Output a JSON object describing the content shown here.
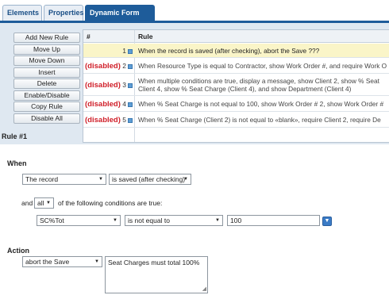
{
  "tabs": [
    {
      "label": "Elements"
    },
    {
      "label": "Properties"
    },
    {
      "label": "Dynamic Form Rules"
    }
  ],
  "sidebar_buttons": [
    "Add New Rule",
    "Move Up",
    "Move Down",
    "Insert",
    "Delete",
    "Enable/Disable",
    "Copy Rule",
    "Disable All"
  ],
  "grid": {
    "header_num": "#",
    "header_rule": "Rule",
    "rows": [
      {
        "disabled": "",
        "num": "1",
        "line1": "When the record is saved (after checking), abort the Save ???",
        "line2": ""
      },
      {
        "disabled": "(disabled)",
        "num": "2",
        "line1": "When Resource Type is equal to Contractor, show Work Order #, and require Work O",
        "line2": ""
      },
      {
        "disabled": "(disabled)",
        "num": "3",
        "line1": "When multiple conditions are true, display a message, show Client 2, show % Seat",
        "line2": "Client 4, show % Seat Charge (Client 4), and show Department (Client 4)"
      },
      {
        "disabled": "(disabled)",
        "num": "4",
        "line1": "When % Seat Charge is not equal to 100, show Work Order # 2, show Work Order #",
        "line2": ""
      },
      {
        "disabled": "(disabled)",
        "num": "5",
        "line1": "When % Seat Charge (Client 2) is not equal to «blank», require Client 2, require De",
        "line2": ""
      }
    ]
  },
  "rule_label": "Rule #1",
  "when": {
    "heading": "When",
    "subject": "The record",
    "event": "is saved (after checking)",
    "and_prefix": "and",
    "quantifier": "all",
    "conditions_suffix": "of the following conditions are true:",
    "condition_field": "SC%Tot",
    "condition_operator": "is not equal to",
    "condition_value": "100"
  },
  "action": {
    "heading": "Action",
    "type": "abort the Save",
    "message": "Seat Charges must total 100%"
  },
  "colors": {
    "tab_active": "#1e5c9a",
    "panel_bg": "#dfe8f1",
    "disabled_text": "#d0202a",
    "selected_row": "#faf5c8"
  }
}
